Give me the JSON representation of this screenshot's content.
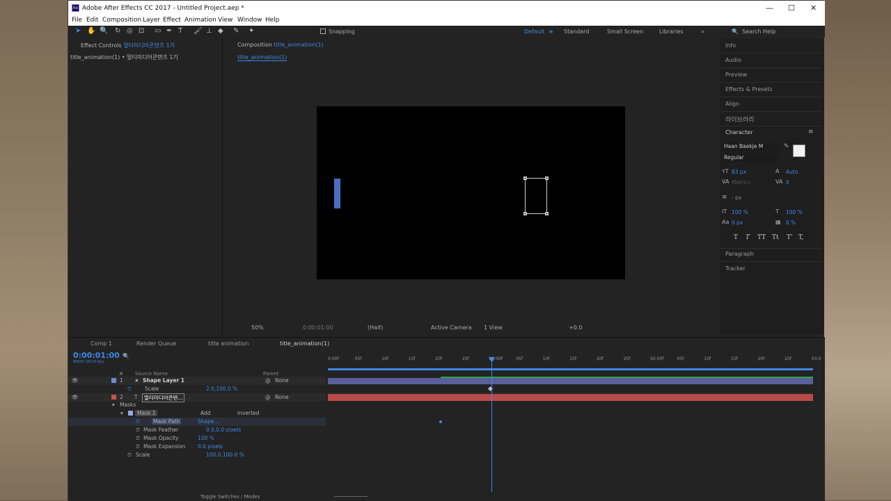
{
  "window": {
    "title": "Adobe After Effects CC 2017 - Untitled Project.aep *",
    "logo": "Ae",
    "min": "—",
    "max": "☐",
    "close": "✕"
  },
  "menu": [
    "File",
    "Edit",
    "Composition",
    "Layer",
    "Effect",
    "Animation",
    "View",
    "Window",
    "Help"
  ],
  "toolbar": {
    "snapping": "Snapping",
    "workspaces": [
      "Default",
      "Standard",
      "Small Screen",
      "Libraries"
    ],
    "search": "Search Help"
  },
  "effect_panel": {
    "tab_label": "Effect Controls",
    "tab_value": "멀티미디어콘텐츠 1기",
    "layer": "title_animation(1) • 멀티미디어콘텐츠 1기"
  },
  "comp_panel": {
    "tab_label": "Composition",
    "tab_value": "title_animation(1)",
    "subtab": "title_animation(1)",
    "footer": {
      "zoom": "50%",
      "time": "0:00:01:00",
      "resolution": "(Half)",
      "camera": "Active Camera",
      "view": "1 View",
      "exposure": "+0.0"
    }
  },
  "right_panel": {
    "items": [
      "Info",
      "Audio",
      "Preview",
      "Effects & Presets",
      "Align",
      "라이브러리",
      "Character"
    ],
    "character": {
      "font": "Haan Baekje M",
      "style": "Regular",
      "size": "83 px",
      "leading": "Auto",
      "kerning": "Metrics",
      "tracking": "0",
      "stroke": "- px",
      "vscale": "100 %",
      "hscale": "100 %",
      "baseline": "0 px",
      "tsume": "0 %",
      "styles": [
        "T",
        "T",
        "TT",
        "Tt",
        "T'",
        "T,"
      ]
    },
    "bottom": [
      "Paragraph",
      "Tracker"
    ]
  },
  "timeline": {
    "tabs": [
      "Comp 1",
      "Render Queue",
      "title animation",
      "title_animation(1)"
    ],
    "timecode": "0:00:01:00",
    "timecode_sub": "00030 (30.00 fps)",
    "headers": {
      "num": "#",
      "source": "Source Name",
      "parent": "Parent"
    },
    "ruler": [
      "0:00f",
      "05f",
      "10f",
      "15f",
      "20f",
      "25f",
      "01:00f",
      "05f",
      "10f",
      "15f",
      "20f",
      "25f",
      "02:00f",
      "05f",
      "10f",
      "15f",
      "20f",
      "25f",
      "03:0"
    ],
    "layers": [
      {
        "num": "1",
        "name": "Shape Layer 1",
        "parent": "None",
        "prop_name": "Scale",
        "prop_value": "2.0,100.0 %"
      },
      {
        "num": "2",
        "name": "멀티미디어콘텐...",
        "parent": "None"
      }
    ],
    "masks": {
      "group": "Masks",
      "mask": "Mask 1",
      "mode": "Add",
      "inverted": "Inverted",
      "props": [
        {
          "name": "Mask Path",
          "value": "Shape..."
        },
        {
          "name": "Mask Feather",
          "value": "0.0,0.0 pixels"
        },
        {
          "name": "Mask Opacity",
          "value": "100 %"
        },
        {
          "name": "Mask Expansion",
          "value": "0.0 pixels"
        }
      ],
      "scale": {
        "name": "Scale",
        "value": "100.0,100.0 %"
      }
    },
    "footer": "Toggle Switches / Modes"
  },
  "colors": {
    "accent": "#3f88e6",
    "layer1_bar": "#5a5f9a",
    "layer2_bar": "#b94a4a",
    "shape_fill": "#4a6fc0"
  }
}
